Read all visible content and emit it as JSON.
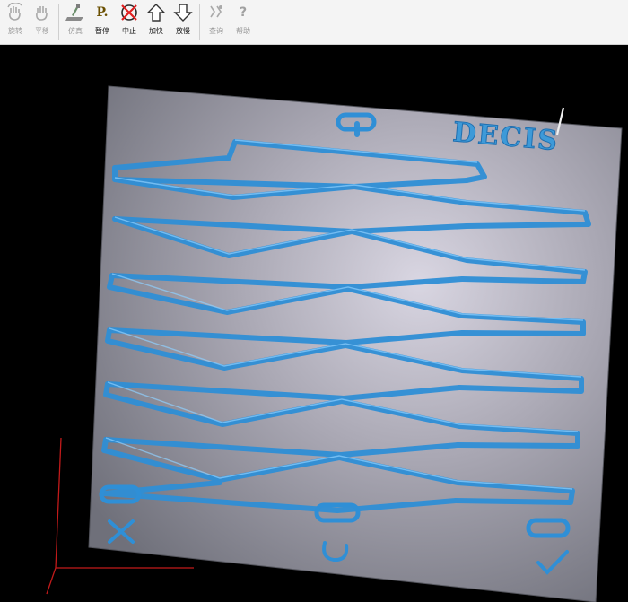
{
  "toolbar": {
    "items": [
      {
        "label": "旋转",
        "icon": "rotate-hand-icon",
        "enabled": false
      },
      {
        "label": "平移",
        "icon": "pan-hand-icon",
        "enabled": false
      },
      {
        "label": "仿真",
        "icon": "simulate-icon",
        "enabled": false
      },
      {
        "label": "暂停",
        "icon": "pause-icon",
        "enabled": true
      },
      {
        "label": "中止",
        "icon": "stop-icon",
        "enabled": true
      },
      {
        "label": "加快",
        "icon": "speed-up-arrow-icon",
        "enabled": true
      },
      {
        "label": "放慢",
        "icon": "slow-down-arrow-icon",
        "enabled": true
      },
      {
        "label": "查询",
        "icon": "query-icon",
        "enabled": false
      },
      {
        "label": "帮助",
        "icon": "help-icon",
        "enabled": false
      }
    ],
    "pause_glyph": "P.",
    "help_glyph": "?"
  },
  "viewport": {
    "engraved_text": "DECIS",
    "colors": {
      "background": "#000000",
      "plate": "#9a9aa6",
      "groove": "#2f8fd6",
      "axis": "#cc1b1b"
    }
  }
}
